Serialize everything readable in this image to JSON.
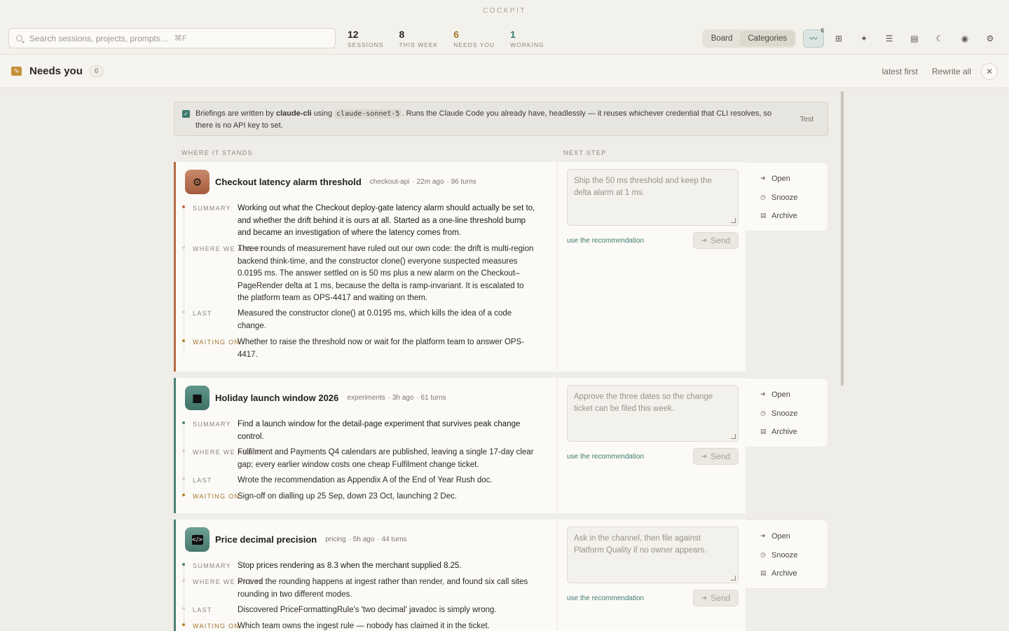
{
  "app": {
    "title": "COCKPIT"
  },
  "search": {
    "placeholder": "Search sessions, projects, prompts…",
    "shortcut": "⌘F"
  },
  "stats": [
    {
      "value": "12",
      "label": "SESSIONS"
    },
    {
      "value": "8",
      "label": "THIS WEEK"
    },
    {
      "value": "6",
      "label": "NEEDS YOU"
    },
    {
      "value": "1",
      "label": "WORKING"
    }
  ],
  "view_toggle": {
    "board": "Board",
    "categories": "Categories"
  },
  "toolbar": {
    "activity_badge": "6"
  },
  "subheader": {
    "title": "Needs you",
    "count": "6",
    "sort": "latest first",
    "rewrite": "Rewrite all"
  },
  "notice": {
    "prefix": "Briefings are written by",
    "tool": "claude-cli",
    "mid": "using",
    "model": "claude-sonnet-5",
    "suffix": ". Runs the Claude Code you already have, headlessly — it reuses whichever credential that CLI resolves, so there is no API key to set.",
    "test": "Test"
  },
  "columns": {
    "left": "WHERE IT STANDS",
    "right": "NEXT STEP"
  },
  "labels": {
    "summary": "SUMMARY",
    "where": "WHERE WE ARE IT",
    "last": "LAST",
    "waiting": "WAITING ON",
    "use_rec": "use the recommendation",
    "send": "Send",
    "open": "Open",
    "snooze": "Snooze",
    "archive": "Archive"
  },
  "cards": [
    {
      "title": "Checkout latency alarm threshold",
      "project": "checkout-api",
      "age": "· 22m ago",
      "turns": "· 96 turns",
      "summary": "Working out what the Checkout deploy-gate latency alarm should actually be set to, and whether the drift behind it is ours at all. Started as a one-line threshold bump and became an investigation of where the latency comes from.",
      "where": "Three rounds of measurement have ruled out our own code: the drift is multi-region backend think-time, and the constructor clone() everyone suspected measures 0.0195 ms. The answer settled on is 50 ms plus a new alarm on the Checkout–PageRender delta at 1 ms, because the delta is ramp-invariant. It is escalated to the platform team as OPS-4417 and waiting on them.",
      "last": "Measured the constructor clone() at 0.0195 ms, which kills the idea of a code change.",
      "waiting": "Whether to raise the threshold now or wait for the platform team to answer OPS-4417.",
      "next": "Ship the 50 ms threshold and keep the delta alarm at 1 ms."
    },
    {
      "title": "Holiday launch window 2026",
      "project": "experiments",
      "age": "· 3h ago",
      "turns": "· 61 turns",
      "summary": "Find a launch window for the detail-page experiment that survives peak change control.",
      "where": "Fulfilment and Payments Q4 calendars are published, leaving a single 17-day clear gap; every earlier window costs one cheap Fulfilment change ticket.",
      "last": "Wrote the recommendation as Appendix A of the End of Year Rush doc.",
      "waiting": "Sign-off on dialling up 25 Sep, down 23 Oct, launching 2 Dec.",
      "next": "Approve the three dates so the change ticket can be filed this week."
    },
    {
      "title": "Price decimal precision",
      "project": "pricing",
      "age": "· 5h ago",
      "turns": "· 44 turns",
      "summary": "Stop prices rendering as 8.3 when the merchant supplied 8.25.",
      "where": "Proved the rounding happens at ingest rather than render, and found six call sites rounding in two different modes.",
      "last": "Discovered PriceFormattingRule's 'two decimal' javadoc is simply wrong.",
      "waiting": "Which team owns the ingest rule — nobody has claimed it in the ticket.",
      "next": "Ask in the channel, then file against Platform Quality if no owner appears."
    }
  ]
}
